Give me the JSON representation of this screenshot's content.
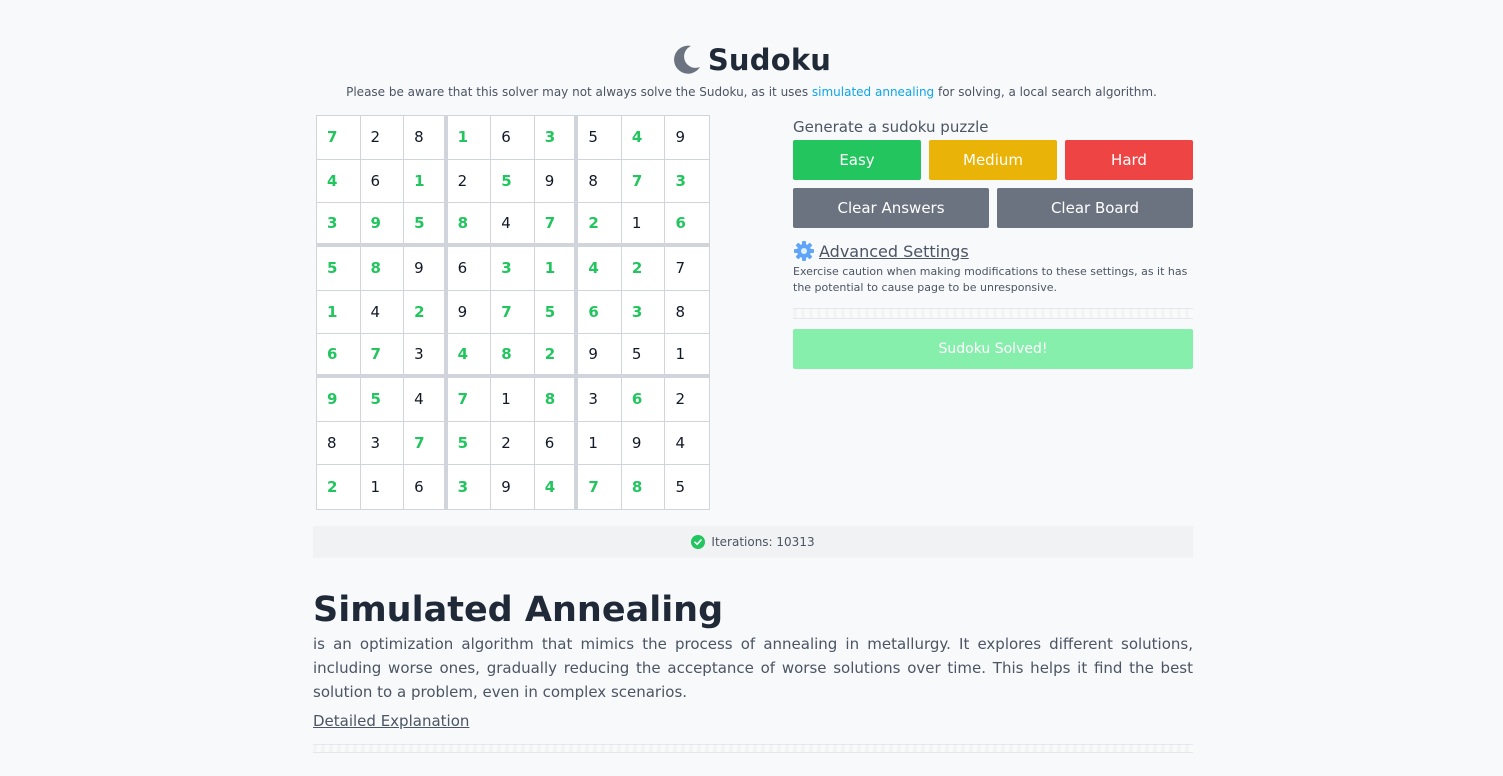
{
  "header": {
    "title": "Sudoku",
    "subtitle_before": "Please be aware that this solver may not always solve the Sudoku, as it uses ",
    "subtitle_link": "simulated annealing",
    "subtitle_after": " for solving, a local search algorithm."
  },
  "board": {
    "rows": [
      [
        "7",
        "2",
        "8",
        "1",
        "6",
        "3",
        "5",
        "4",
        "9"
      ],
      [
        "4",
        "6",
        "1",
        "2",
        "5",
        "9",
        "8",
        "7",
        "3"
      ],
      [
        "3",
        "9",
        "5",
        "8",
        "4",
        "7",
        "2",
        "1",
        "6"
      ],
      [
        "5",
        "8",
        "9",
        "6",
        "3",
        "1",
        "4",
        "2",
        "7"
      ],
      [
        "1",
        "4",
        "2",
        "9",
        "7",
        "5",
        "6",
        "3",
        "8"
      ],
      [
        "6",
        "7",
        "3",
        "4",
        "8",
        "2",
        "9",
        "5",
        "1"
      ],
      [
        "9",
        "5",
        "4",
        "7",
        "1",
        "8",
        "3",
        "6",
        "2"
      ],
      [
        "8",
        "3",
        "7",
        "5",
        "2",
        "6",
        "1",
        "9",
        "4"
      ],
      [
        "2",
        "1",
        "6",
        "3",
        "9",
        "4",
        "7",
        "8",
        "5"
      ]
    ],
    "given": [
      [
        1,
        0,
        0,
        1,
        0,
        1,
        0,
        1,
        0
      ],
      [
        1,
        0,
        1,
        0,
        1,
        0,
        0,
        1,
        1
      ],
      [
        1,
        1,
        1,
        1,
        0,
        1,
        1,
        0,
        1
      ],
      [
        1,
        1,
        0,
        0,
        1,
        1,
        1,
        1,
        0
      ],
      [
        1,
        0,
        1,
        0,
        1,
        1,
        1,
        1,
        0
      ],
      [
        1,
        1,
        0,
        1,
        1,
        1,
        0,
        0,
        0
      ],
      [
        1,
        1,
        0,
        1,
        0,
        1,
        0,
        1,
        0
      ],
      [
        0,
        0,
        1,
        1,
        0,
        0,
        0,
        0,
        0
      ],
      [
        1,
        0,
        0,
        1,
        0,
        1,
        1,
        1,
        0
      ]
    ],
    "given_color": "#22c55e"
  },
  "panel": {
    "generate_label": "Generate a sudoku puzzle",
    "easy_label": "Easy",
    "medium_label": "Medium",
    "hard_label": "Hard",
    "clear_answers_label": "Clear Answers",
    "clear_board_label": "Clear Board",
    "advanced_label": "Advanced Settings",
    "advanced_note": "Exercise caution when making modifications to these settings, as it has the potential to cause page to be unresponsive.",
    "solved_label": "Sudoku Solved!",
    "colors": {
      "easy": "#22c55e",
      "medium": "#eab308",
      "hard": "#ef4444",
      "gray": "#6b7280",
      "solved": "#86efac"
    }
  },
  "status": {
    "iterations_text": "Iterations: 10313",
    "icon": "check-circle-icon"
  },
  "article": {
    "heading": "Simulated Annealing",
    "body": "is an optimization algorithm that mimics the process of annealing in metallurgy. It explores different solutions, including worse ones, gradually reducing the acceptance of worse solutions over time. This helps it find the best solution to a problem, even in complex scenarios.",
    "link_label": "Detailed Explanation"
  }
}
